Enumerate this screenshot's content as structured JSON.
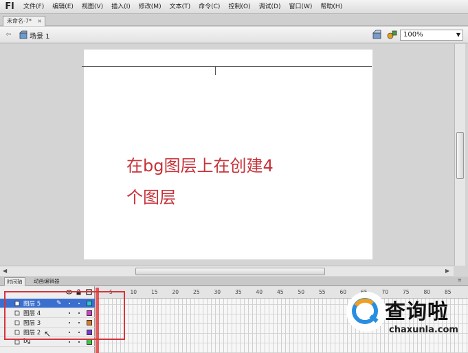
{
  "app": {
    "logo": "Fl"
  },
  "menu": [
    "文件(F)",
    "编辑(E)",
    "视图(V)",
    "插入(I)",
    "修改(M)",
    "文本(T)",
    "命令(C)",
    "控制(O)",
    "调试(D)",
    "窗口(W)",
    "帮助(H)"
  ],
  "doc_tab": {
    "title": "未命名-7*",
    "close": "×"
  },
  "editbar": {
    "back": "⇦",
    "scene": "场景 1",
    "zoom": "100%"
  },
  "stage": {
    "line1": "在bg图层上在创建4",
    "line2": "个图层",
    "text_color": "#c6333a",
    "background": "#ffffff"
  },
  "scroll": {
    "left": "◀",
    "right": "▶",
    "grip": "≡"
  },
  "timeline": {
    "tabs": [
      "时间轴",
      "动画编辑器"
    ],
    "frame_numbers": [
      "5",
      "10",
      "15",
      "20",
      "25",
      "30",
      "35",
      "40",
      "45",
      "50",
      "55",
      "60",
      "65",
      "70",
      "75",
      "80",
      "85"
    ],
    "layers": [
      {
        "name": "图层 5",
        "selected": true,
        "color": "#27c8e0"
      },
      {
        "name": "图层 4",
        "selected": false,
        "color": "#d43cd0"
      },
      {
        "name": "图层 3",
        "selected": false,
        "color": "#e07a20"
      },
      {
        "name": "图层 2",
        "selected": false,
        "color": "#7a3ad0"
      },
      {
        "name": "bg",
        "selected": false,
        "color": "#3bc840"
      }
    ],
    "highlight_color": "#d6333c"
  },
  "watermark": {
    "title": "查询啦",
    "url": "chaxunla.com"
  }
}
